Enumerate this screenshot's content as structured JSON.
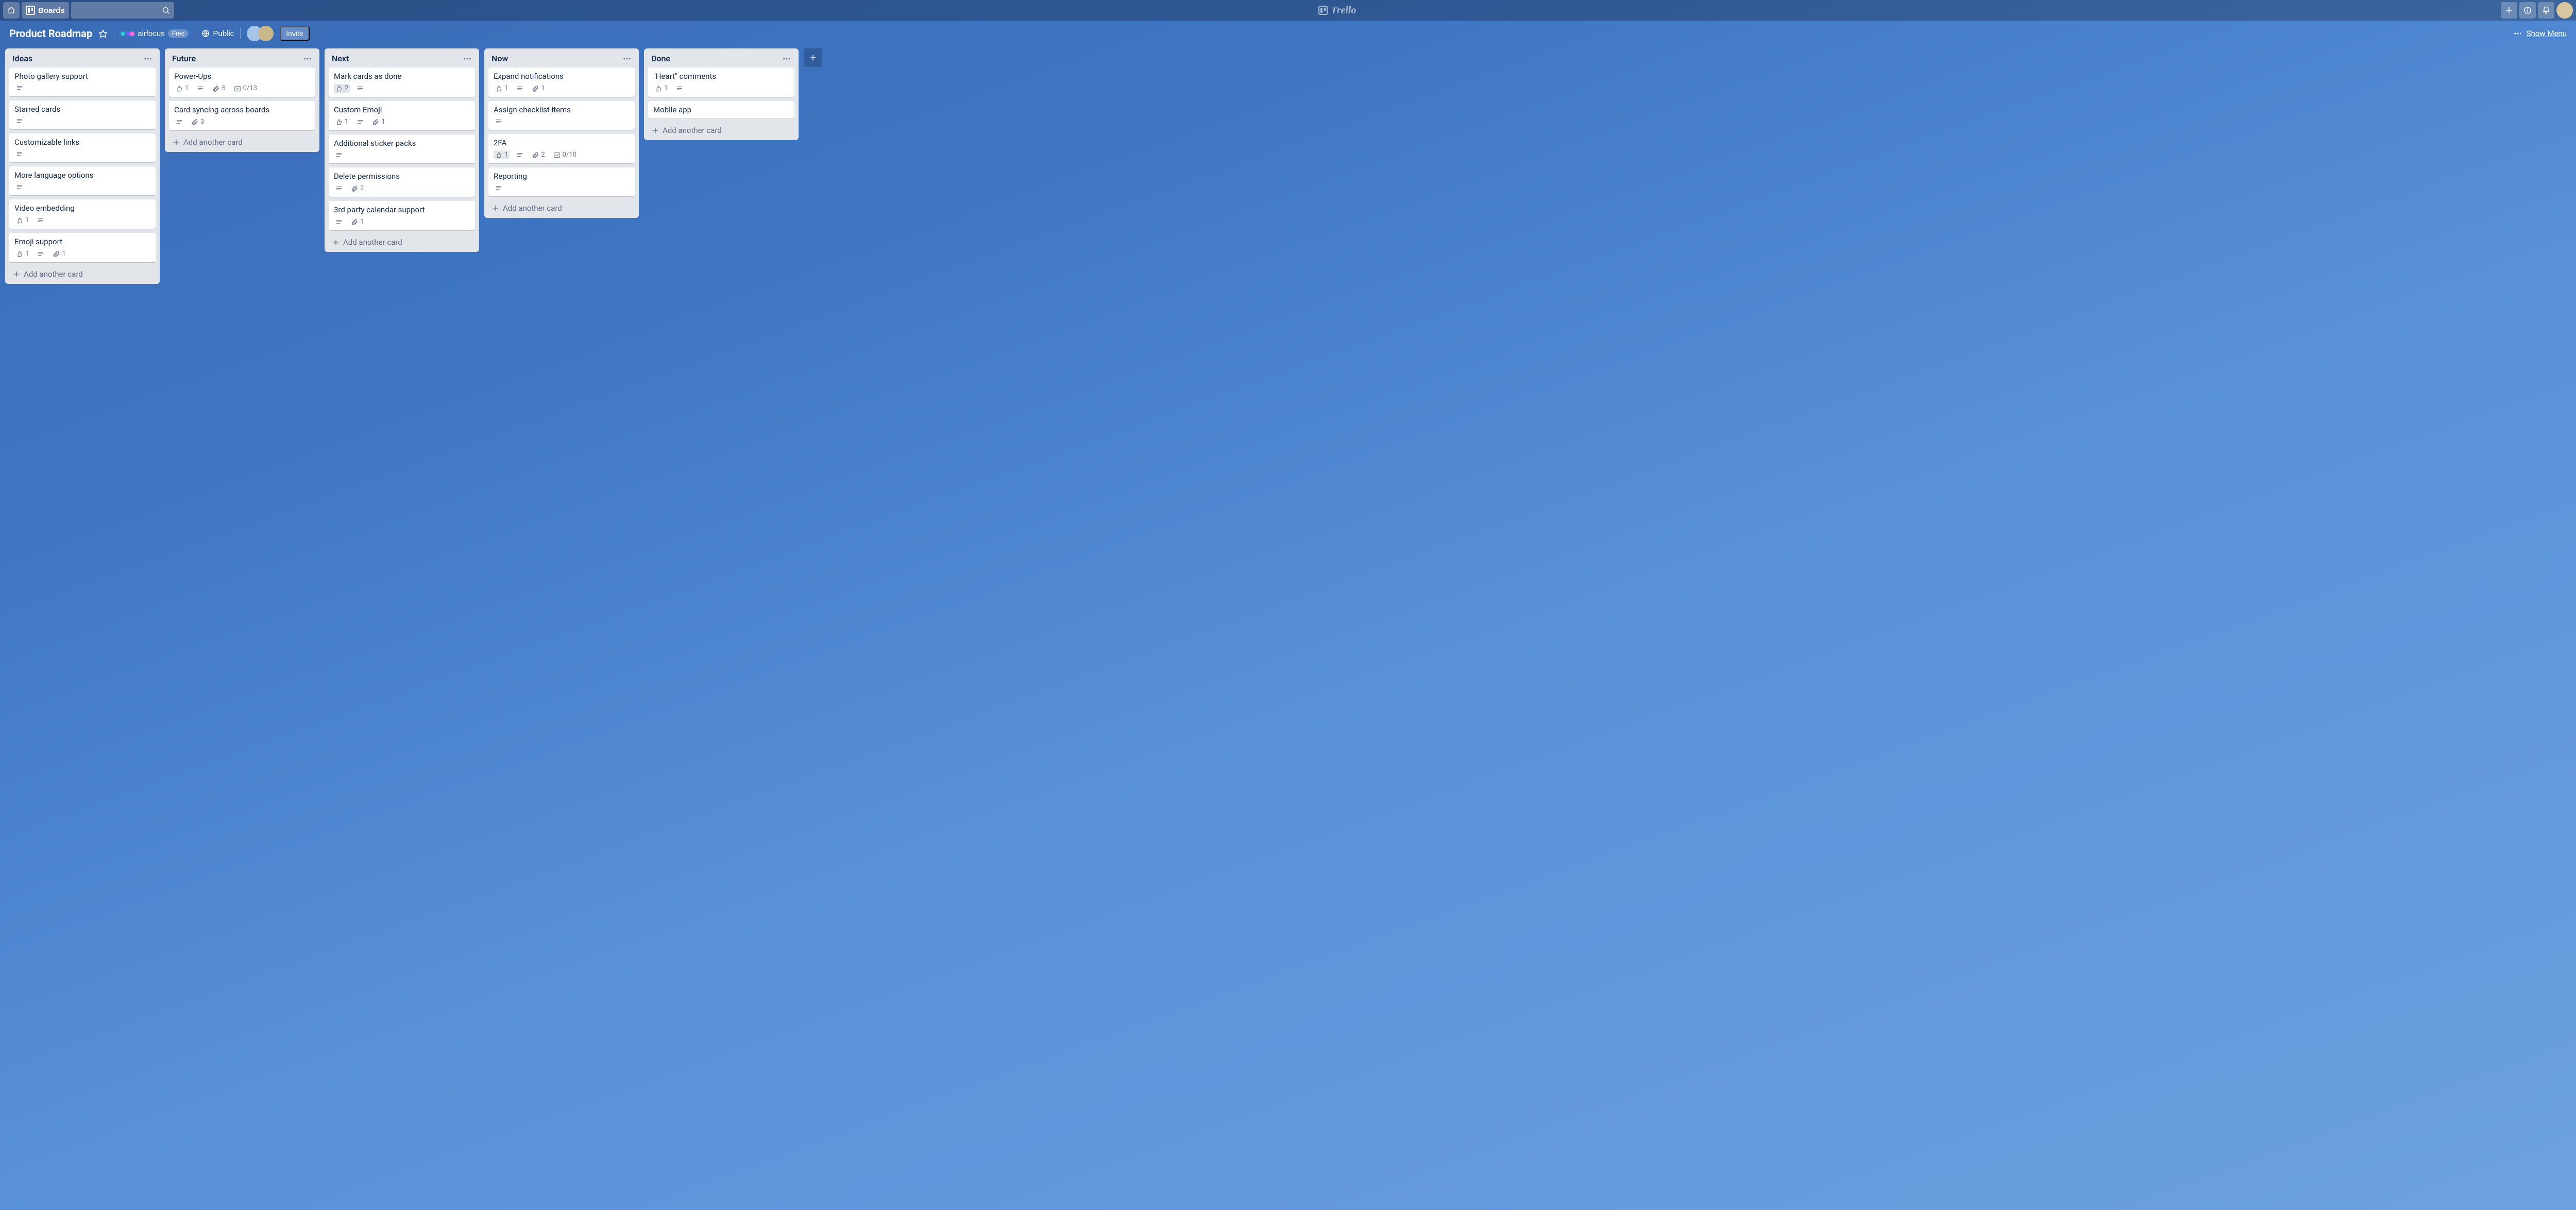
{
  "header": {
    "boards_button": "Boards",
    "logo_text": "Trello",
    "search_placeholder": ""
  },
  "board_header": {
    "title": "Product Roadmap",
    "team_label": "airfocus",
    "team_plan": "Free",
    "visibility": "Public",
    "invite_label": "Invite",
    "show_menu": "Show Menu"
  },
  "lists": [
    {
      "title": "Ideas",
      "cards": [
        {
          "title": "Photo gallery support",
          "badges": {
            "desc": true
          }
        },
        {
          "title": "Starred cards",
          "badges": {
            "desc": true
          }
        },
        {
          "title": "Customizable links",
          "badges": {
            "desc": true
          }
        },
        {
          "title": "More language options",
          "badges": {
            "desc": true
          }
        },
        {
          "title": "Video embedding",
          "badges": {
            "votes": "1",
            "desc": true
          }
        },
        {
          "title": "Emoji support",
          "badges": {
            "votes": "1",
            "desc": true,
            "attachments": "1"
          }
        }
      ],
      "add_label": "Add another card"
    },
    {
      "title": "Future",
      "cards": [
        {
          "title": "Power-Ups",
          "badges": {
            "votes": "1",
            "desc": true,
            "attachments": "5",
            "checklist": "0/13"
          }
        },
        {
          "title": "Card syncing across boards",
          "badges": {
            "desc": true,
            "attachments": "3"
          }
        }
      ],
      "add_label": "Add another card"
    },
    {
      "title": "Next",
      "cards": [
        {
          "title": "Mark cards as done",
          "badges": {
            "votes": "2",
            "votes_voted": true,
            "desc": true
          }
        },
        {
          "title": "Custom Emoji",
          "badges": {
            "votes": "1",
            "desc": true,
            "attachments": "1"
          }
        },
        {
          "title": "Additional sticker packs",
          "badges": {
            "desc": true
          }
        },
        {
          "title": "Delete permissions",
          "badges": {
            "desc": true,
            "attachments": "2"
          }
        },
        {
          "title": "3rd party calendar support",
          "badges": {
            "desc": true,
            "attachments": "1"
          }
        }
      ],
      "add_label": "Add another card"
    },
    {
      "title": "Now",
      "cards": [
        {
          "title": "Expand notifications",
          "badges": {
            "votes": "1",
            "desc": true,
            "attachments": "1"
          }
        },
        {
          "title": "Assign checklist items",
          "badges": {
            "desc": true
          }
        },
        {
          "title": "2FA",
          "badges": {
            "votes": "1",
            "votes_voted": true,
            "desc": true,
            "attachments": "2",
            "checklist": "0/10"
          }
        },
        {
          "title": "Reporting",
          "badges": {
            "desc": true
          }
        }
      ],
      "add_label": "Add another card"
    },
    {
      "title": "Done",
      "cards": [
        {
          "title": "\"Heart\" comments",
          "badges": {
            "votes": "1",
            "desc": true
          }
        },
        {
          "title": "Mobile app",
          "badges": {}
        }
      ],
      "add_label": "Add another card"
    }
  ]
}
